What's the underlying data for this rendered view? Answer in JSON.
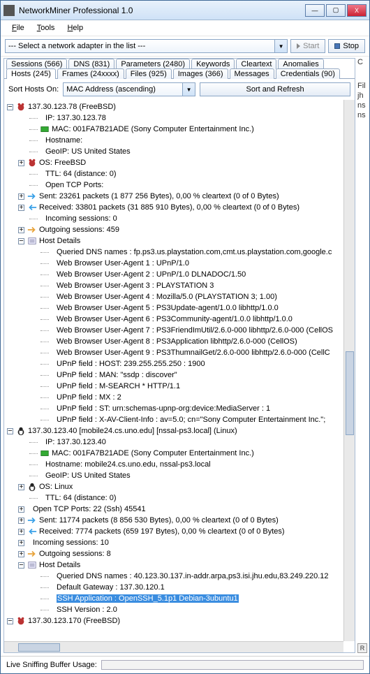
{
  "window": {
    "title": "NetworkMiner Professional 1.0",
    "min": "—",
    "max": "▢",
    "close": "X"
  },
  "menu": {
    "file": "File",
    "tools": "Tools",
    "help": "Help"
  },
  "adapter": {
    "placeholder": "--- Select a network adapter in the list ---",
    "start": "Start",
    "stop": "Stop"
  },
  "tabs_row1": {
    "sessions": "Sessions (566)",
    "dns": "DNS (831)",
    "parameters": "Parameters (2480)",
    "keywords": "Keywords",
    "cleartext": "Cleartext",
    "anomalies": "Anomalies"
  },
  "tabs_row2": {
    "hosts": "Hosts (245)",
    "frames": "Frames (24xxxx)",
    "files": "Files (925)",
    "images": "Images (366)",
    "messages": "Messages",
    "credentials": "Credentials (90)"
  },
  "sort": {
    "label": "Sort Hosts On:",
    "value": "MAC Address (ascending)",
    "button": "Sort and Refresh"
  },
  "right": {
    "c": "C",
    "fil": "Fil",
    "jh": "jh",
    "ns1": "ns",
    "ns2": "ns",
    "r": "R"
  },
  "tree": {
    "h1": {
      "head": "137.30.123.78 (FreeBSD)",
      "ip": "IP: 137.30.123.78",
      "mac": "MAC: 001FA7B21ADE (Sony Computer Entertainment Inc.)",
      "hostname": "Hostname:",
      "geoip": "GeoIP: US United States",
      "os": "OS: FreeBSD",
      "ttl": "TTL: 64 (distance: 0)",
      "openports": "Open TCP Ports:",
      "sent": "Sent: 23261 packets (1 877 256 Bytes), 0,00 % cleartext (0 of 0 Bytes)",
      "recv": "Received: 33801 packets (31 885 910 Bytes), 0,00 % cleartext (0 of 0 Bytes)",
      "insess": "Incoming sessions: 0",
      "outsess": "Outgoing sessions: 459",
      "hostdet": "Host Details",
      "details": [
        "Queried DNS names : fp.ps3.us.playstation.com,cmt.us.playstation.com,google.c",
        "Web Browser User-Agent 1 : UPnP/1.0",
        "Web Browser User-Agent 2 : UPnP/1.0 DLNADOC/1.50",
        "Web Browser User-Agent 3 : PLAYSTATION 3",
        "Web Browser User-Agent 4 : Mozilla/5.0 (PLAYSTATION 3; 1.00)",
        "Web Browser User-Agent 5 : PS3Update-agent/1.0.0 libhttp/1.0.0",
        "Web Browser User-Agent 6 : PS3Community-agent/1.0.0 libhttp/1.0.0",
        "Web Browser User-Agent 7 : PS3FriendImUtil/2.6.0-000 libhttp/2.6.0-000 (CellOS",
        "Web Browser User-Agent 8 : PS3Application libhttp/2.6.0-000 (CellOS)",
        "Web Browser User-Agent 9 : PS3ThumnailGet/2.6.0-000 libhttp/2.6.0-000 (CellC",
        "UPnP field : HOST: 239.255.255.250 : 1900",
        "UPnP field : MAN: \"ssdp : discover\"",
        "UPnP field : M-SEARCH * HTTP/1.1",
        "UPnP field : MX :  2",
        "UPnP field : ST: urn:schemas-upnp-org:device:MediaServer : 1",
        "UPnP field : X-AV-Client-Info :  av=5.0; cn=\"Sony Computer Entertainment Inc.\";"
      ]
    },
    "h2": {
      "head": "137.30.123.40 [mobile24.cs.uno.edu] [nssal-ps3.local] (Linux)",
      "ip": "IP: 137.30.123.40",
      "mac": "MAC: 001FA7B21ADE (Sony Computer Entertainment Inc.)",
      "hostname": "Hostname: mobile24.cs.uno.edu, nssal-ps3.local",
      "geoip": "GeoIP: US United States",
      "os": "OS: Linux",
      "ttl": "TTL: 64 (distance: 0)",
      "openports": "Open TCP Ports: 22 (Ssh) 45541",
      "sent": "Sent: 11774 packets (8 856 530 Bytes), 0,00 % cleartext (0 of 0 Bytes)",
      "recv": "Received: 7774 packets (659 197 Bytes), 0,00 % cleartext (0 of 0 Bytes)",
      "insess": "Incoming sessions: 10",
      "outsess": "Outgoing sessions: 8",
      "hostdet": "Host Details",
      "details": [
        "Queried DNS names : 40.123.30.137.in-addr.arpa,ps3.isi.jhu.edu,83.249.220.12",
        "Default Gateway : 137.30.120.1",
        "SSH Application : OpenSSH_5.1p1 Debian-3ubuntu1",
        "SSH Version : 2.0"
      ]
    },
    "h3": {
      "head": "137.30.123.170 (FreeBSD)"
    }
  },
  "status": {
    "label": "Live Sniffing Buffer Usage:"
  }
}
